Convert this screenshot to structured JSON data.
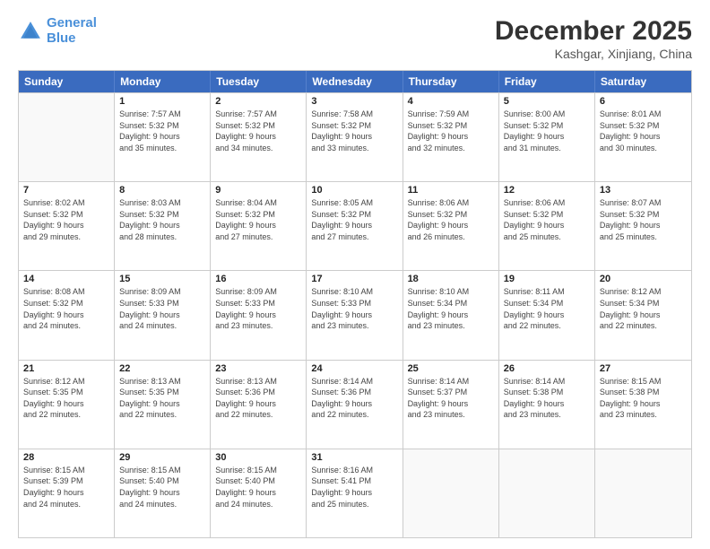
{
  "header": {
    "logo_line1": "General",
    "logo_line2": "Blue",
    "month": "December 2025",
    "location": "Kashgar, Xinjiang, China"
  },
  "weekdays": [
    "Sunday",
    "Monday",
    "Tuesday",
    "Wednesday",
    "Thursday",
    "Friday",
    "Saturday"
  ],
  "weeks": [
    [
      {
        "day": "",
        "info": ""
      },
      {
        "day": "1",
        "info": "Sunrise: 7:57 AM\nSunset: 5:32 PM\nDaylight: 9 hours\nand 35 minutes."
      },
      {
        "day": "2",
        "info": "Sunrise: 7:57 AM\nSunset: 5:32 PM\nDaylight: 9 hours\nand 34 minutes."
      },
      {
        "day": "3",
        "info": "Sunrise: 7:58 AM\nSunset: 5:32 PM\nDaylight: 9 hours\nand 33 minutes."
      },
      {
        "day": "4",
        "info": "Sunrise: 7:59 AM\nSunset: 5:32 PM\nDaylight: 9 hours\nand 32 minutes."
      },
      {
        "day": "5",
        "info": "Sunrise: 8:00 AM\nSunset: 5:32 PM\nDaylight: 9 hours\nand 31 minutes."
      },
      {
        "day": "6",
        "info": "Sunrise: 8:01 AM\nSunset: 5:32 PM\nDaylight: 9 hours\nand 30 minutes."
      }
    ],
    [
      {
        "day": "7",
        "info": "Sunrise: 8:02 AM\nSunset: 5:32 PM\nDaylight: 9 hours\nand 29 minutes."
      },
      {
        "day": "8",
        "info": "Sunrise: 8:03 AM\nSunset: 5:32 PM\nDaylight: 9 hours\nand 28 minutes."
      },
      {
        "day": "9",
        "info": "Sunrise: 8:04 AM\nSunset: 5:32 PM\nDaylight: 9 hours\nand 27 minutes."
      },
      {
        "day": "10",
        "info": "Sunrise: 8:05 AM\nSunset: 5:32 PM\nDaylight: 9 hours\nand 27 minutes."
      },
      {
        "day": "11",
        "info": "Sunrise: 8:06 AM\nSunset: 5:32 PM\nDaylight: 9 hours\nand 26 minutes."
      },
      {
        "day": "12",
        "info": "Sunrise: 8:06 AM\nSunset: 5:32 PM\nDaylight: 9 hours\nand 25 minutes."
      },
      {
        "day": "13",
        "info": "Sunrise: 8:07 AM\nSunset: 5:32 PM\nDaylight: 9 hours\nand 25 minutes."
      }
    ],
    [
      {
        "day": "14",
        "info": "Sunrise: 8:08 AM\nSunset: 5:32 PM\nDaylight: 9 hours\nand 24 minutes."
      },
      {
        "day": "15",
        "info": "Sunrise: 8:09 AM\nSunset: 5:33 PM\nDaylight: 9 hours\nand 24 minutes."
      },
      {
        "day": "16",
        "info": "Sunrise: 8:09 AM\nSunset: 5:33 PM\nDaylight: 9 hours\nand 23 minutes."
      },
      {
        "day": "17",
        "info": "Sunrise: 8:10 AM\nSunset: 5:33 PM\nDaylight: 9 hours\nand 23 minutes."
      },
      {
        "day": "18",
        "info": "Sunrise: 8:10 AM\nSunset: 5:34 PM\nDaylight: 9 hours\nand 23 minutes."
      },
      {
        "day": "19",
        "info": "Sunrise: 8:11 AM\nSunset: 5:34 PM\nDaylight: 9 hours\nand 22 minutes."
      },
      {
        "day": "20",
        "info": "Sunrise: 8:12 AM\nSunset: 5:34 PM\nDaylight: 9 hours\nand 22 minutes."
      }
    ],
    [
      {
        "day": "21",
        "info": "Sunrise: 8:12 AM\nSunset: 5:35 PM\nDaylight: 9 hours\nand 22 minutes."
      },
      {
        "day": "22",
        "info": "Sunrise: 8:13 AM\nSunset: 5:35 PM\nDaylight: 9 hours\nand 22 minutes."
      },
      {
        "day": "23",
        "info": "Sunrise: 8:13 AM\nSunset: 5:36 PM\nDaylight: 9 hours\nand 22 minutes."
      },
      {
        "day": "24",
        "info": "Sunrise: 8:14 AM\nSunset: 5:36 PM\nDaylight: 9 hours\nand 22 minutes."
      },
      {
        "day": "25",
        "info": "Sunrise: 8:14 AM\nSunset: 5:37 PM\nDaylight: 9 hours\nand 23 minutes."
      },
      {
        "day": "26",
        "info": "Sunrise: 8:14 AM\nSunset: 5:38 PM\nDaylight: 9 hours\nand 23 minutes."
      },
      {
        "day": "27",
        "info": "Sunrise: 8:15 AM\nSunset: 5:38 PM\nDaylight: 9 hours\nand 23 minutes."
      }
    ],
    [
      {
        "day": "28",
        "info": "Sunrise: 8:15 AM\nSunset: 5:39 PM\nDaylight: 9 hours\nand 24 minutes."
      },
      {
        "day": "29",
        "info": "Sunrise: 8:15 AM\nSunset: 5:40 PM\nDaylight: 9 hours\nand 24 minutes."
      },
      {
        "day": "30",
        "info": "Sunrise: 8:15 AM\nSunset: 5:40 PM\nDaylight: 9 hours\nand 24 minutes."
      },
      {
        "day": "31",
        "info": "Sunrise: 8:16 AM\nSunset: 5:41 PM\nDaylight: 9 hours\nand 25 minutes."
      },
      {
        "day": "",
        "info": ""
      },
      {
        "day": "",
        "info": ""
      },
      {
        "day": "",
        "info": ""
      }
    ]
  ]
}
